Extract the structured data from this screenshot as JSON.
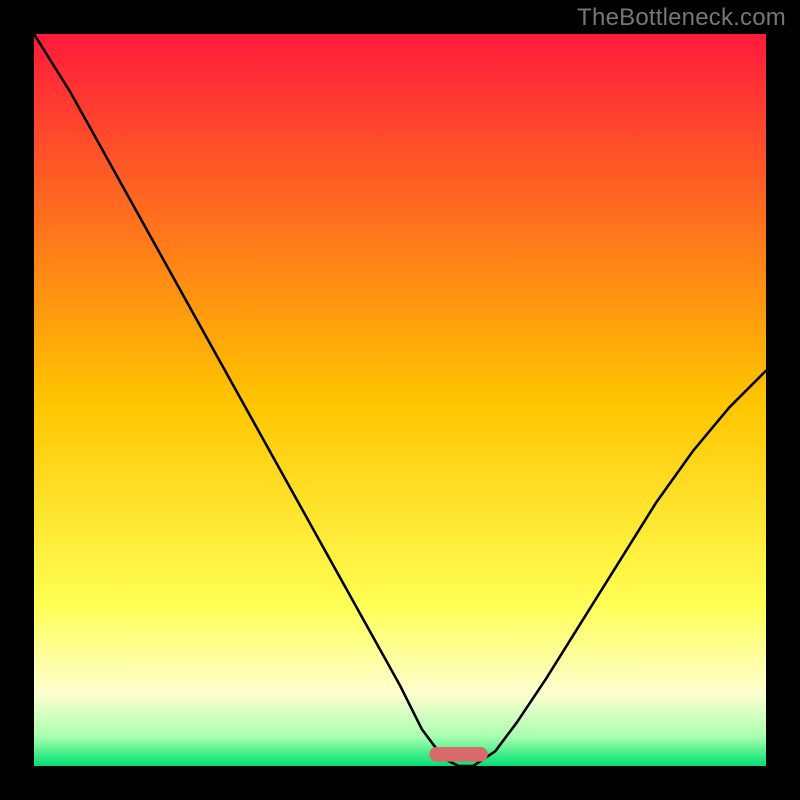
{
  "watermark": "TheBottleneck.com",
  "colors": {
    "frame_bg": "#000000",
    "curve": "#000000",
    "marker": "#d96a6a",
    "gradient_stops": [
      {
        "offset": 0,
        "color": "#ff1a3c"
      },
      {
        "offset": 50,
        "color": "#ffc400"
      },
      {
        "offset": 78,
        "color": "#ffff55"
      },
      {
        "offset": 90,
        "color": "#ffffd0"
      },
      {
        "offset": 96,
        "color": "#a8ffb0"
      },
      {
        "offset": 100,
        "color": "#00e070"
      }
    ]
  },
  "chart_data": {
    "type": "line",
    "title": "",
    "xlabel": "",
    "ylabel": "",
    "xlim": [
      0,
      100
    ],
    "ylim": [
      0,
      100
    ],
    "series": [
      {
        "name": "bottleneck-curve",
        "x": [
          0,
          5,
          10,
          15,
          20,
          25,
          30,
          35,
          40,
          45,
          50,
          53,
          56,
          58,
          60,
          63,
          66,
          70,
          75,
          80,
          85,
          90,
          95,
          100
        ],
        "y": [
          100,
          92,
          83,
          74,
          65,
          56,
          47,
          38,
          29,
          20,
          11,
          5,
          1,
          0,
          0,
          2,
          6,
          12,
          20,
          28,
          36,
          43,
          49,
          54
        ]
      }
    ],
    "marker": {
      "x_center": 58,
      "width": 8,
      "height": 2
    }
  }
}
